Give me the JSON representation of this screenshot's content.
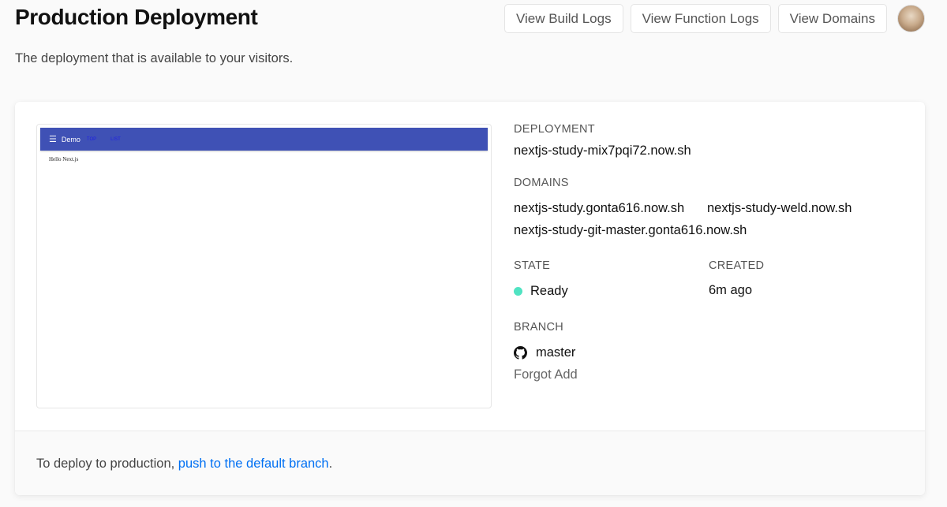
{
  "header": {
    "title": "Production Deployment",
    "subtitle": "The deployment that is available to your visitors.",
    "buttons": {
      "build_logs": "View Build Logs",
      "function_logs": "View Function Logs",
      "domains": "View Domains"
    }
  },
  "preview": {
    "app_title": "Demo",
    "nav_links": [
      "TOP",
      "LIST"
    ],
    "body_text": "Hello Next.js",
    "bar_color": "#3f51b5"
  },
  "deployment": {
    "label": "DEPLOYMENT",
    "url": "nextjs-study-mix7pqi72.now.sh"
  },
  "domains": {
    "label": "DOMAINS",
    "items": [
      "nextjs-study.gonta616.now.sh",
      "nextjs-study-weld.now.sh",
      "nextjs-study-git-master.gonta616.now.sh"
    ]
  },
  "state": {
    "label": "STATE",
    "value": "Ready",
    "color": "#50e3c2"
  },
  "created": {
    "label": "CREATED",
    "value": "6m ago"
  },
  "branch": {
    "label": "BRANCH",
    "name": "master",
    "commit_message": "Forgot Add"
  },
  "footer": {
    "text": "To deploy to production, ",
    "link": "push to the default branch",
    "suffix": "."
  }
}
